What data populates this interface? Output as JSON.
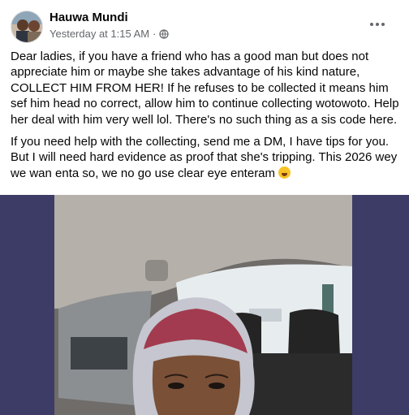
{
  "post": {
    "author": "Hauwa Mundi",
    "timestamp": "Yesterday at 1:15 AM",
    "separator": "·",
    "audience_icon": "globe-icon",
    "more_icon": "more-options-icon",
    "paragraphs": [
      "Dear ladies, if you have a friend who has a good man but does not appreciate him or maybe she takes advantage of his kind nature, COLLECT HIM FROM HER! If he refuses to be collected it means him sef him head no correct,  allow him to continue collecting wotowoto. Help her deal with him very well lol.  There's no such thing as a sis code here.",
      "If you need help with the collecting, send me a DM, I have tips for you. But I will need hard evidence as proof that she's tripping. This 2026 wey we wan enta so, we no go use clear eye enteram"
    ],
    "emoji": "laughing-emoji"
  },
  "colors": {
    "text": "#050505",
    "secondary": "#65676b",
    "media_background": "#3c3c66"
  }
}
